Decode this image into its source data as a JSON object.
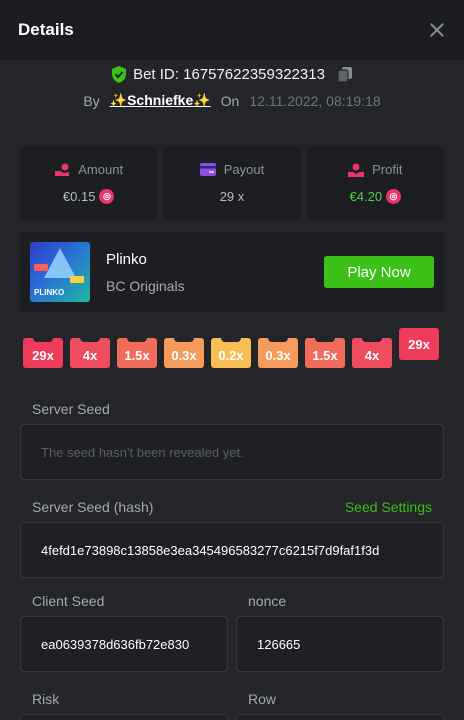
{
  "header": {
    "title": "Details"
  },
  "bet": {
    "id_label": "Bet ID: 16757622359322313",
    "by_label": "By",
    "user_prefix": "✨",
    "user_name": "Schniefke",
    "user_suffix": "✨",
    "on_label": "On",
    "timestamp": "12.11.2022, 08:19:18"
  },
  "stats": {
    "amount_label": "Amount",
    "amount_value": "€0.15",
    "payout_label": "Payout",
    "payout_value": "29 x",
    "profit_label": "Profit",
    "profit_value": "€4.20"
  },
  "game": {
    "thumb_text": "PLINKO",
    "name": "Plinko",
    "provider": "BC Originals",
    "play_label": "Play Now"
  },
  "multipliers": [
    {
      "label": "29x",
      "color": "#ef3c5a"
    },
    {
      "label": "4x",
      "color": "#ef4d5f"
    },
    {
      "label": "1.5x",
      "color": "#f26c5c"
    },
    {
      "label": "0.3x",
      "color": "#f59b5b"
    },
    {
      "label": "0.2x",
      "color": "#f8bd55"
    },
    {
      "label": "0.3x",
      "color": "#f59b5b"
    },
    {
      "label": "1.5x",
      "color": "#f26c5c"
    },
    {
      "label": "4x",
      "color": "#ef4d5f"
    },
    {
      "label": "29x",
      "color": "#ef3c5a"
    }
  ],
  "fields": {
    "server_seed_label": "Server Seed",
    "server_seed_placeholder": "The seed hasn't been revealed yet.",
    "server_hash_label": "Server Seed (hash)",
    "seed_settings_label": "Seed Settings",
    "server_hash_value": "4fefd1e73898c13858e3ea345496583277c6215f7d9faf1f3d",
    "client_seed_label": "Client Seed",
    "client_seed_value": "ea0639378d636fb72e830",
    "nonce_label": "nonce",
    "nonce_value": "126665",
    "risk_label": "Risk",
    "row_label": "Row"
  }
}
